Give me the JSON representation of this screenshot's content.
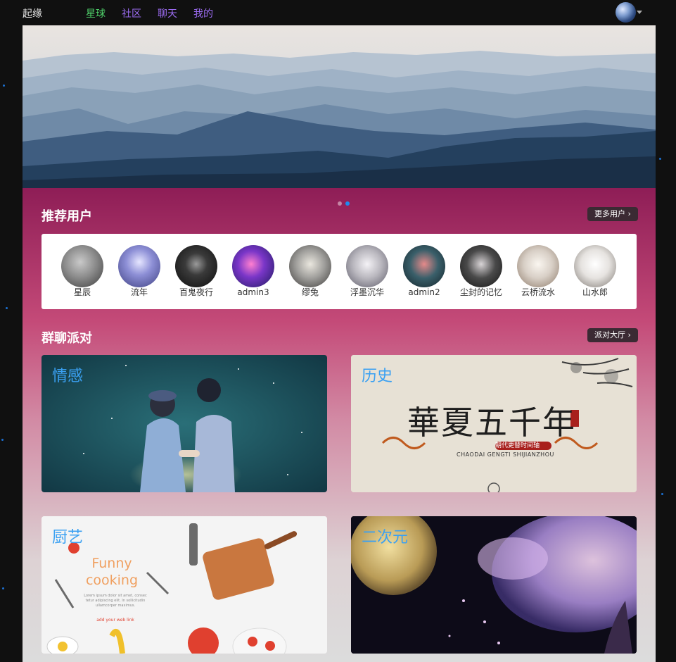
{
  "nav": {
    "brand": "起缘",
    "links": [
      {
        "label": "星球",
        "color": "#4fd06a"
      },
      {
        "label": "社区",
        "color": "#9c6cf2"
      },
      {
        "label": "聊天",
        "color": "#9c6cf2"
      },
      {
        "label": "我的",
        "color": "#9c6cf2"
      }
    ]
  },
  "carousel": {
    "active_index": 1,
    "slides": 2
  },
  "recommended_users": {
    "title": "推荐用户",
    "more_label": "更多用户 ›",
    "users": [
      {
        "name": "星辰",
        "color": "#8c8c8c"
      },
      {
        "name": "流年",
        "color": "#6e6fb8"
      },
      {
        "name": "百鬼夜行",
        "color": "#1e1e1e"
      },
      {
        "name": "admin3",
        "color": "#6b2fb0"
      },
      {
        "name": "缪兔",
        "color": "#a09f9c"
      },
      {
        "name": "浮墨沉华",
        "color": "#b9b7be"
      },
      {
        "name": "admin2",
        "color": "#3a5f6a"
      },
      {
        "name": "尘封的记忆",
        "color": "#4a4a4a"
      },
      {
        "name": "云桥流水",
        "color": "#d8cfc6"
      },
      {
        "name": "山水郎",
        "color": "#e6e3e0"
      }
    ]
  },
  "party": {
    "title": "群聊派对",
    "more_label": "派对大厅 ›",
    "rooms": [
      {
        "label": "情感"
      },
      {
        "label": "历史",
        "image_title": "華夏五千年",
        "image_badge": "朝代更替时间轴",
        "image_subtitle": "CHAODAI GENGTI SHIJIANZHOU"
      },
      {
        "label": "厨艺",
        "image_title": "Funny cooking",
        "image_text": "Lorem ipsum dolor sit amet, consec tetur adipiscing elit. In sollicitudin ullamcorper maximus.",
        "image_link": "add your web link"
      },
      {
        "label": "二次元"
      }
    ]
  }
}
